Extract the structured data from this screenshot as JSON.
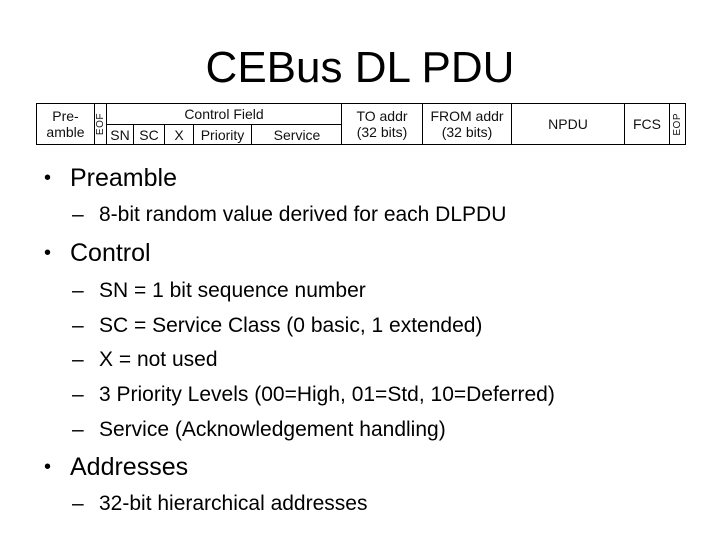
{
  "slide": {
    "title": "CEBus DL PDU"
  },
  "frame_diagram": {
    "preamble": [
      "Pre-",
      "amble"
    ],
    "eof": "EOF",
    "control_field": {
      "label": "Control Field",
      "subfields": [
        "SN",
        "SC",
        "X",
        "Priority",
        "Service"
      ]
    },
    "to_addr": [
      "TO addr",
      "(32 bits)"
    ],
    "from_addr": [
      "FROM addr",
      "(32 bits)"
    ],
    "npdu": "NPDU",
    "fcs": "FCS",
    "eop": "EOP"
  },
  "bullets": [
    {
      "symbol": "•",
      "text": "Preamble",
      "subitems": [
        {
          "symbol": "–",
          "text": "8-bit random value derived for each DLPDU"
        }
      ]
    },
    {
      "symbol": "•",
      "text": "Control",
      "subitems": [
        {
          "symbol": "–",
          "text": "SN = 1 bit sequence number"
        },
        {
          "symbol": "–",
          "text": "SC = Service Class (0 basic, 1 extended)"
        },
        {
          "symbol": "–",
          "text": "X = not used"
        },
        {
          "symbol": "–",
          "text": "3 Priority Levels (00=High, 01=Std, 10=Deferred)"
        },
        {
          "symbol": "–",
          "text": "Service (Acknowledgement handling)"
        }
      ]
    },
    {
      "symbol": "•",
      "text": "Addresses",
      "subitems": [
        {
          "symbol": "–",
          "text": "32-bit hierarchical addresses"
        }
      ]
    }
  ]
}
